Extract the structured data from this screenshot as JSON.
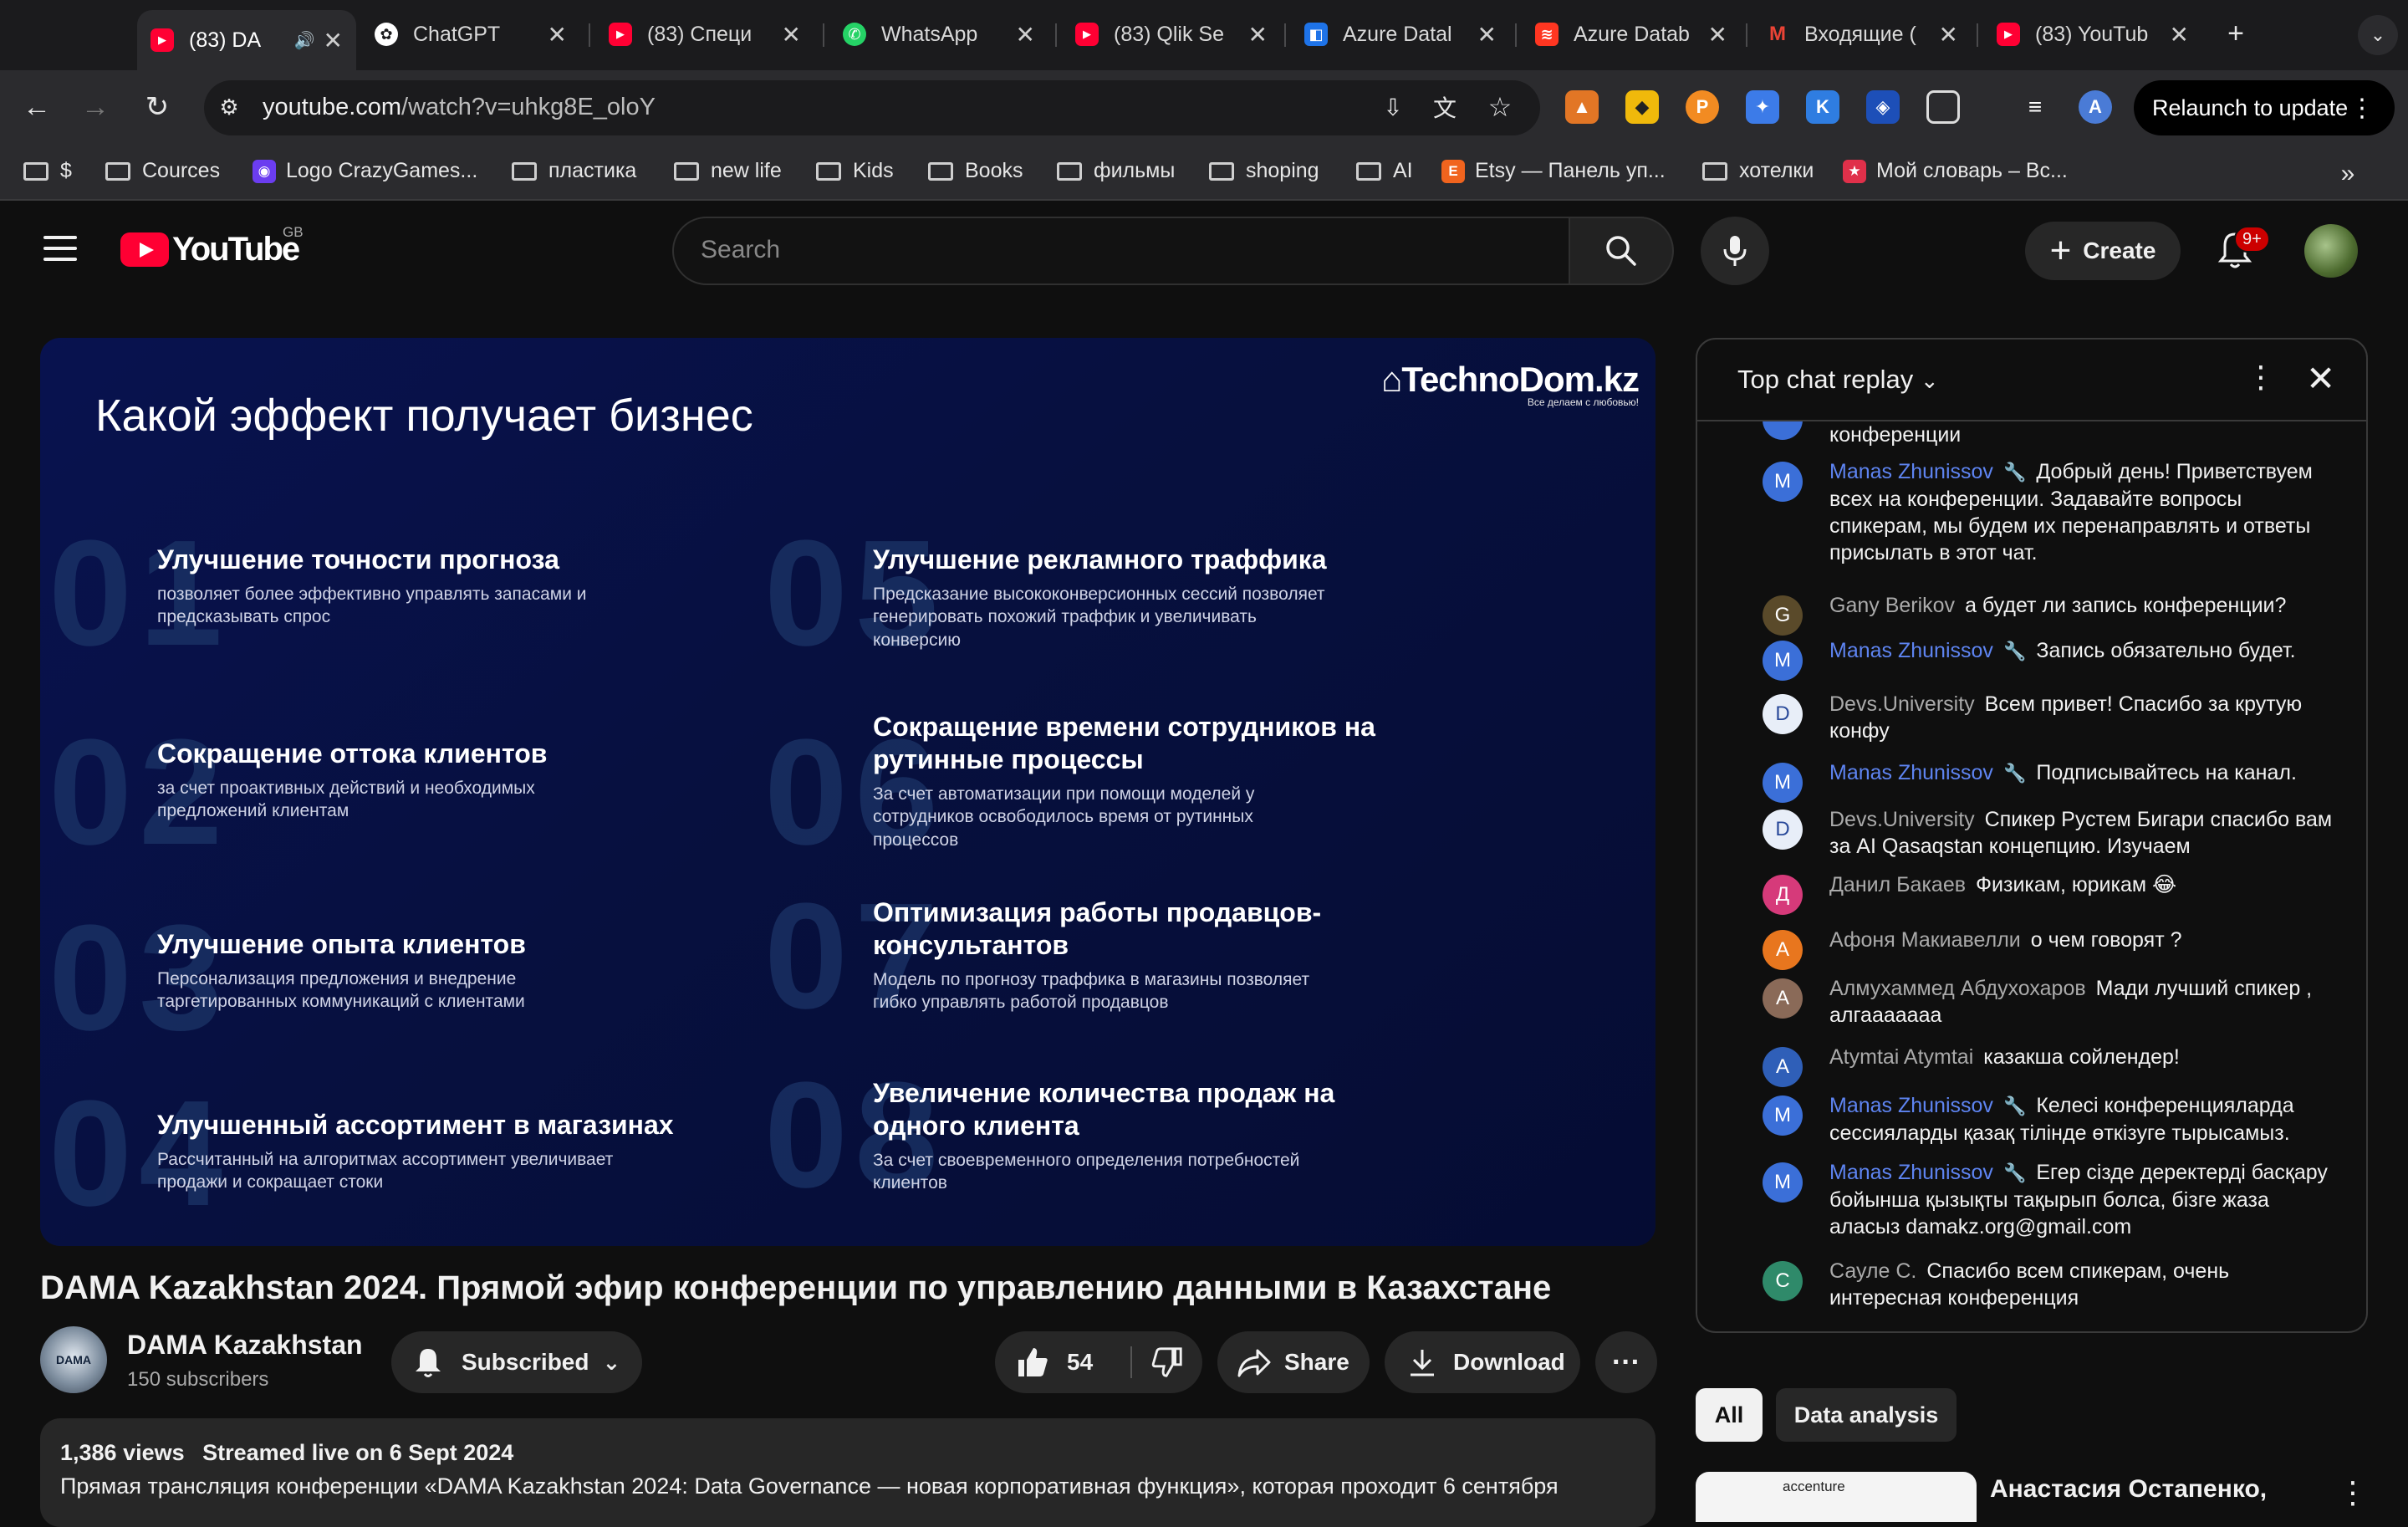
{
  "browser": {
    "tabs": [
      {
        "label": "(83) DA",
        "icon": "youtube-icon",
        "color": "#ff0033",
        "active": true
      },
      {
        "label": "ChatGPT",
        "icon": "chatgpt-icon",
        "color": "#ffffff"
      },
      {
        "label": "(83) Специ",
        "icon": "youtube-icon",
        "color": "#ff0033"
      },
      {
        "label": "WhatsApp",
        "icon": "whatsapp-icon",
        "color": "#25d366"
      },
      {
        "label": "(83) Qlik Se",
        "icon": "youtube-icon",
        "color": "#ff0033"
      },
      {
        "label": "Azure Datal",
        "icon": "azure-databricks-icon",
        "color": "#1e73e8"
      },
      {
        "label": "Azure Datab",
        "icon": "databricks-icon",
        "color": "#ff3621"
      },
      {
        "label": "Входящие (",
        "icon": "gmail-icon",
        "color": "#ea4335"
      },
      {
        "label": "(83) YouTub",
        "icon": "youtube-icon",
        "color": "#ff0033"
      }
    ],
    "url_domain": "youtube.com",
    "url_path": "/watch?v=uhkg8E_oloY",
    "relaunch_label": "Relaunch to update",
    "bookmarks": [
      {
        "label": "$",
        "icon": "folder-icon"
      },
      {
        "label": "Cources",
        "icon": "folder-icon"
      },
      {
        "label": "Logo CrazyGames...",
        "icon": "crazygames-icon"
      },
      {
        "label": "пластика",
        "icon": "folder-icon"
      },
      {
        "label": "new life",
        "icon": "folder-icon"
      },
      {
        "label": "Kids",
        "icon": "folder-icon"
      },
      {
        "label": "Books",
        "icon": "folder-icon"
      },
      {
        "label": "фильмы",
        "icon": "folder-icon"
      },
      {
        "label": "shoping",
        "icon": "folder-icon"
      },
      {
        "label": "AI",
        "icon": "folder-icon"
      },
      {
        "label": "Etsy — Панель уп...",
        "icon": "etsy-icon"
      },
      {
        "label": "хотелки",
        "icon": "folder-icon"
      },
      {
        "label": "Мой словарь – Вс...",
        "icon": "dictionary-icon"
      }
    ]
  },
  "youtube": {
    "country_code": "GB",
    "search_placeholder": "Search",
    "create_label": "Create",
    "notification_count": "9+"
  },
  "video": {
    "slide": {
      "title": "Какой эффект получает бизнес",
      "brand": "TechnoDom.kz",
      "brand_tagline": "Все делаем с любовью!",
      "items": [
        {
          "num": "01",
          "title": "Улучшение точности прогноза",
          "desc": "позволяет более эффективно управлять запасами и предсказывать спрос"
        },
        {
          "num": "02",
          "title": "Сокращение оттока клиентов",
          "desc": "за счет проактивных действий и необходимых предложений клиентам"
        },
        {
          "num": "03",
          "title": "Улучшение опыта клиентов",
          "desc": "Персонализация предложения и внедрение таргетированных коммуникаций с клиентами"
        },
        {
          "num": "04",
          "title": "Улучшенный ассортимент в магазинах",
          "desc": "Рассчитанный на алгоритмах ассортимент увеличивает продажи и сокращает стоки"
        },
        {
          "num": "05",
          "title": "Улучшение рекламного траффика",
          "desc": "Предсказание высококонверсионных сессий позволяет генерировать похожий траффик и увеличивать конверсию"
        },
        {
          "num": "06",
          "title": "Сокращение времени сотрудников на рутинные процессы",
          "desc": "За счет автоматизации при помощи моделей у сотрудников освободилось время от рутинных процессов"
        },
        {
          "num": "07",
          "title": "Оптимизация работы продавцов-консультантов",
          "desc": "Модель по прогнозу траффика в магазины позволяет гибко управлять работой продавцов"
        },
        {
          "num": "08",
          "title": "Увеличение количества продаж на одного клиента",
          "desc": "За счет своевременного определения потребностей клиентов"
        }
      ]
    },
    "title": "DAMA Kazakhstan 2024. Прямой эфир конференции по управлению данными в Казахстане",
    "channel": {
      "name": "DAMA Kazakhstan",
      "subscribers": "150 subscribers",
      "avatar_text": "DAMA"
    },
    "subscribed_label": "Subscribed",
    "likes": "54",
    "share_label": "Share",
    "download_label": "Download",
    "views": "1,386 views",
    "streamed": "Streamed live on 6 Sept 2024",
    "description": "Прямая трансляция конференции «DAMA Kazakhstan 2024: Data Governance — новая корпоративная функция», которая проходит 6 сентября"
  },
  "chat": {
    "title": "Top chat replay",
    "partial_text": "конференции",
    "messages": [
      {
        "author": "Manas Zhunissov",
        "mod": true,
        "initial": "M",
        "color": "#3b6fd8",
        "text": "Добрый день! Приветствуем всех на конференции. Задавайте вопросы спикерам, мы будем их перенаправлять и ответы присылать в этот чат."
      },
      {
        "author": "Gany Berikov",
        "mod": false,
        "initial": "G",
        "color": "#5a4a2a",
        "text": "а будет ли запись конференции?"
      },
      {
        "author": "Manas Zhunissov",
        "mod": true,
        "initial": "M",
        "color": "#3b6fd8",
        "text": "Запись обязательно будет."
      },
      {
        "author": "Devs.University",
        "mod": false,
        "initial": "D",
        "color": "#e8eef8",
        "text": "Всем привет! Спасибо за крутую конфу"
      },
      {
        "author": "Manas Zhunissov",
        "mod": true,
        "initial": "M",
        "color": "#3b6fd8",
        "text": "Подписывайтесь на канал."
      },
      {
        "author": "Devs.University",
        "mod": false,
        "initial": "D",
        "color": "#e8eef8",
        "text": "Спикер Рустем Бигари спасибо вам за AI Qasaqstan концепцию. Изучаем"
      },
      {
        "author": "Данил Бакаев",
        "mod": false,
        "initial": "Д",
        "color": "#d63a7a",
        "text": "Физикам, юрикам 😂"
      },
      {
        "author": "Афоня Макиавелли",
        "mod": false,
        "initial": "А",
        "color": "#e8761e",
        "text": "о чем говорят ?"
      },
      {
        "author": "Алмухаммед Абдухохаров",
        "mod": false,
        "initial": "А",
        "color": "#8a6a58",
        "text": "Мади лучший спикер , алгааааааа"
      },
      {
        "author": "Atymtai Atymtai",
        "mod": false,
        "initial": "A",
        "color": "#2f5fb8",
        "text": "казакша сойлендер!"
      },
      {
        "author": "Manas Zhunissov",
        "mod": true,
        "initial": "M",
        "color": "#3b6fd8",
        "text": "Келесі конференцияларда сессияларды қазақ тілінде өткізуге тырысамыз."
      },
      {
        "author": "Manas Zhunissov",
        "mod": true,
        "initial": "M",
        "color": "#3b6fd8",
        "text": "Егер сізде деректерді басқару бойынша қызықты тақырып болса, бізге жаза аласыз damakz.org@gmail.com"
      },
      {
        "author": "Сауле С.",
        "mod": false,
        "initial": "C",
        "color": "#2f8a6a",
        "text": "Спасибо всем спикерам, очень интересная конференция"
      }
    ]
  },
  "chips": [
    {
      "label": "All",
      "active": true
    },
    {
      "label": "Data analysis",
      "active": false
    }
  ],
  "recommendation": {
    "title": "Анастасия Остапенко,",
    "thumb_label": "accenture"
  }
}
